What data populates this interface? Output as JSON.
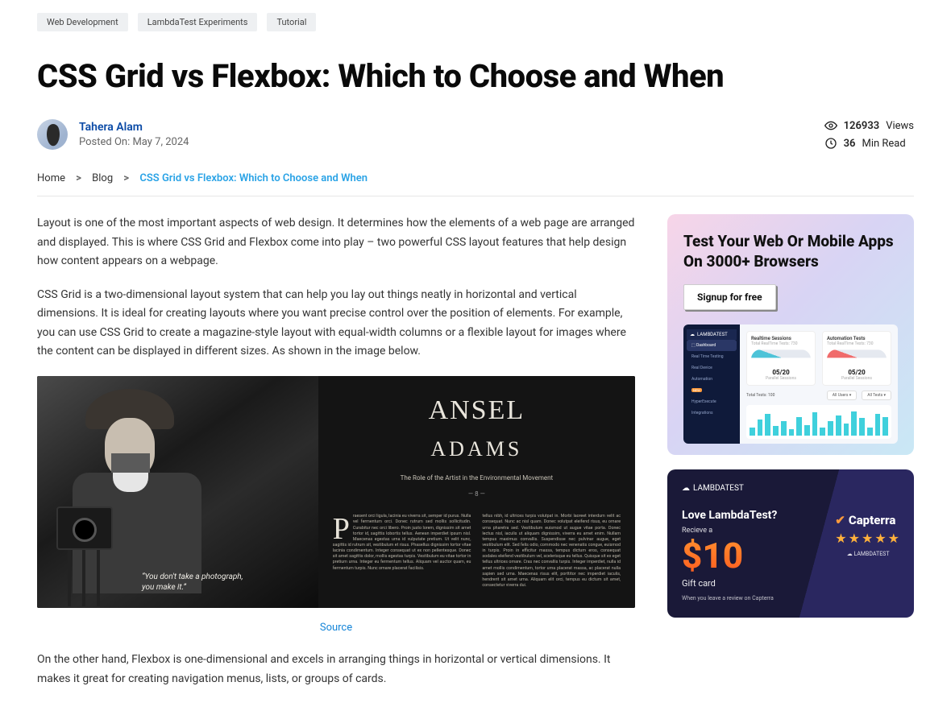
{
  "tags": [
    "Web Development",
    "LambdaTest Experiments",
    "Tutorial"
  ],
  "title": "CSS Grid vs Flexbox: Which to Choose and When",
  "author": {
    "name": "Tahera Alam",
    "posted_label": "Posted On: May 7, 2024"
  },
  "stats": {
    "views_value": "126933",
    "views_label": "Views",
    "read_value": "36",
    "read_label": "Min Read"
  },
  "breadcrumb": {
    "home": "Home",
    "blog": "Blog",
    "current": "CSS Grid vs Flexbox: Which to Choose and When"
  },
  "paragraphs": {
    "p1": "Layout is one of the most important aspects of web design. It determines how the elements of a web page are arranged and displayed. This is where CSS Grid and Flexbox come into play – two powerful CSS layout features that help design how content appears on a webpage.",
    "p2": "CSS Grid is a two-dimensional layout system that can help you lay out things neatly in horizontal and vertical dimensions. It is ideal for creating layouts where you want precise control over the position of elements. For example, you can use CSS Grid to create a magazine-style layout with equal-width columns or a flexible layout for images where the content can be displayed in different sizes. As shown in the image below.",
    "p3": "On the other hand, Flexbox is one-dimensional and excels in arranging things in horizontal or vertical dimensions. It makes it great for creating navigation menus, lists, or groups of cards."
  },
  "source_link": "Source",
  "magazine": {
    "big1": "ANSEL",
    "big2": "ADAMS",
    "role": "The Role of the Artist in the Environmental Movement",
    "quote": "“You don't take a photograph, you make it.”"
  },
  "cta": {
    "line1": "Test Your Web Or Mobile Apps",
    "line2": "On 3000+ Browsers",
    "button": "Signup for free",
    "brand": "LAMBDATEST",
    "nav": [
      "Dashboard",
      "Real Time Testing",
      "Real Device",
      "Automation",
      "HyperExecute",
      "Integrations"
    ],
    "card1_label": "Realtime Sessions",
    "card1_sub": "Total RealTime Tests: 730",
    "card1_num": "05/20",
    "card1_foot": "Parallel Sessions",
    "card2_label": "Automation Tests",
    "card2_sub": "Total RealTime Tests: 730",
    "card2_num": "05/20",
    "card2_foot": "Parallel Sessions",
    "total_tests": "Total Tests: 100",
    "sel1": "All Users",
    "sel2": "All Tests"
  },
  "promo": {
    "brand": "LAMBDATEST",
    "love": "Love LambdaTest?",
    "recieve": "Recieve a",
    "amount": "$10",
    "gift": "Gift card",
    "sub": "When you leave a review on Capterra",
    "capterra": "Capterra",
    "ltsmall": "LAMBDATEST"
  }
}
